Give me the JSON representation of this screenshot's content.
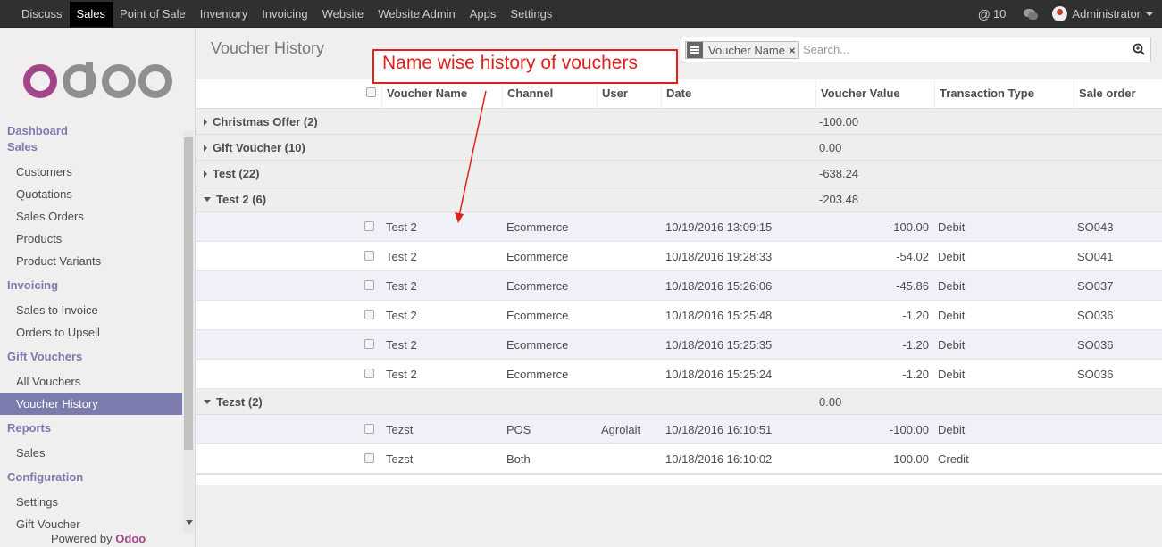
{
  "topbar": {
    "menu": [
      "Discuss",
      "Sales",
      "Point of Sale",
      "Inventory",
      "Invoicing",
      "Website",
      "Website Admin",
      "Apps",
      "Settings"
    ],
    "active": "Sales",
    "notif_count": "10",
    "user": "Administrator"
  },
  "logo": "odoo",
  "sidebar": {
    "sections": [
      {
        "title": "Dashboard",
        "items": []
      },
      {
        "title": "Sales",
        "items": [
          "Customers",
          "Quotations",
          "Sales Orders",
          "Products",
          "Product Variants"
        ]
      },
      {
        "title": "Invoicing",
        "items": [
          "Sales to Invoice",
          "Orders to Upsell"
        ]
      },
      {
        "title": "Gift Vouchers",
        "items": [
          "All Vouchers",
          "Voucher History"
        ]
      },
      {
        "title": "Reports",
        "items": [
          "Sales"
        ]
      },
      {
        "title": "Configuration",
        "items": [
          "Settings",
          "Gift Voucher"
        ]
      }
    ],
    "active_item": "Voucher History",
    "powered_prefix": "Powered by ",
    "powered_brand": "Odoo"
  },
  "page_title": "Voucher History",
  "search": {
    "facet_label": "Voucher Name",
    "placeholder": "Search..."
  },
  "annotation": "Name wise history of vouchers",
  "columns": [
    "Voucher Name",
    "Channel",
    "User",
    "Date",
    "Voucher Value",
    "Transaction Type",
    "Sale order"
  ],
  "groups": [
    {
      "label": "Christmas Offer (2)",
      "value": "-100.00",
      "expanded": false,
      "rows": []
    },
    {
      "label": "Gift Voucher (10)",
      "value": "0.00",
      "expanded": false,
      "rows": []
    },
    {
      "label": "Test (22)",
      "value": "-638.24",
      "expanded": false,
      "rows": []
    },
    {
      "label": "Test 2 (6)",
      "value": "-203.48",
      "expanded": true,
      "rows": [
        {
          "name": "Test 2",
          "channel": "Ecommerce",
          "user": "",
          "date": "10/19/2016 13:09:15",
          "value": "-100.00",
          "type": "Debit",
          "so": "SO043"
        },
        {
          "name": "Test 2",
          "channel": "Ecommerce",
          "user": "",
          "date": "10/18/2016 19:28:33",
          "value": "-54.02",
          "type": "Debit",
          "so": "SO041"
        },
        {
          "name": "Test 2",
          "channel": "Ecommerce",
          "user": "",
          "date": "10/18/2016 15:26:06",
          "value": "-45.86",
          "type": "Debit",
          "so": "SO037"
        },
        {
          "name": "Test 2",
          "channel": "Ecommerce",
          "user": "",
          "date": "10/18/2016 15:25:48",
          "value": "-1.20",
          "type": "Debit",
          "so": "SO036"
        },
        {
          "name": "Test 2",
          "channel": "Ecommerce",
          "user": "",
          "date": "10/18/2016 15:25:35",
          "value": "-1.20",
          "type": "Debit",
          "so": "SO036"
        },
        {
          "name": "Test 2",
          "channel": "Ecommerce",
          "user": "",
          "date": "10/18/2016 15:25:24",
          "value": "-1.20",
          "type": "Debit",
          "so": "SO036"
        }
      ]
    },
    {
      "label": "Tezst (2)",
      "value": "0.00",
      "expanded": true,
      "rows": [
        {
          "name": "Tezst",
          "channel": "POS",
          "user": "Agrolait",
          "date": "10/18/2016 16:10:51",
          "value": "-100.00",
          "type": "Debit",
          "so": ""
        },
        {
          "name": "Tezst",
          "channel": "Both",
          "user": "",
          "date": "10/18/2016 16:10:02",
          "value": "100.00",
          "type": "Credit",
          "so": ""
        }
      ]
    }
  ],
  "colors": {
    "accent": "#7c7bad",
    "topbar": "#303030",
    "annotation": "#e0201b",
    "logo_purple": "#a24689",
    "logo_gray": "#8f8f8f"
  }
}
